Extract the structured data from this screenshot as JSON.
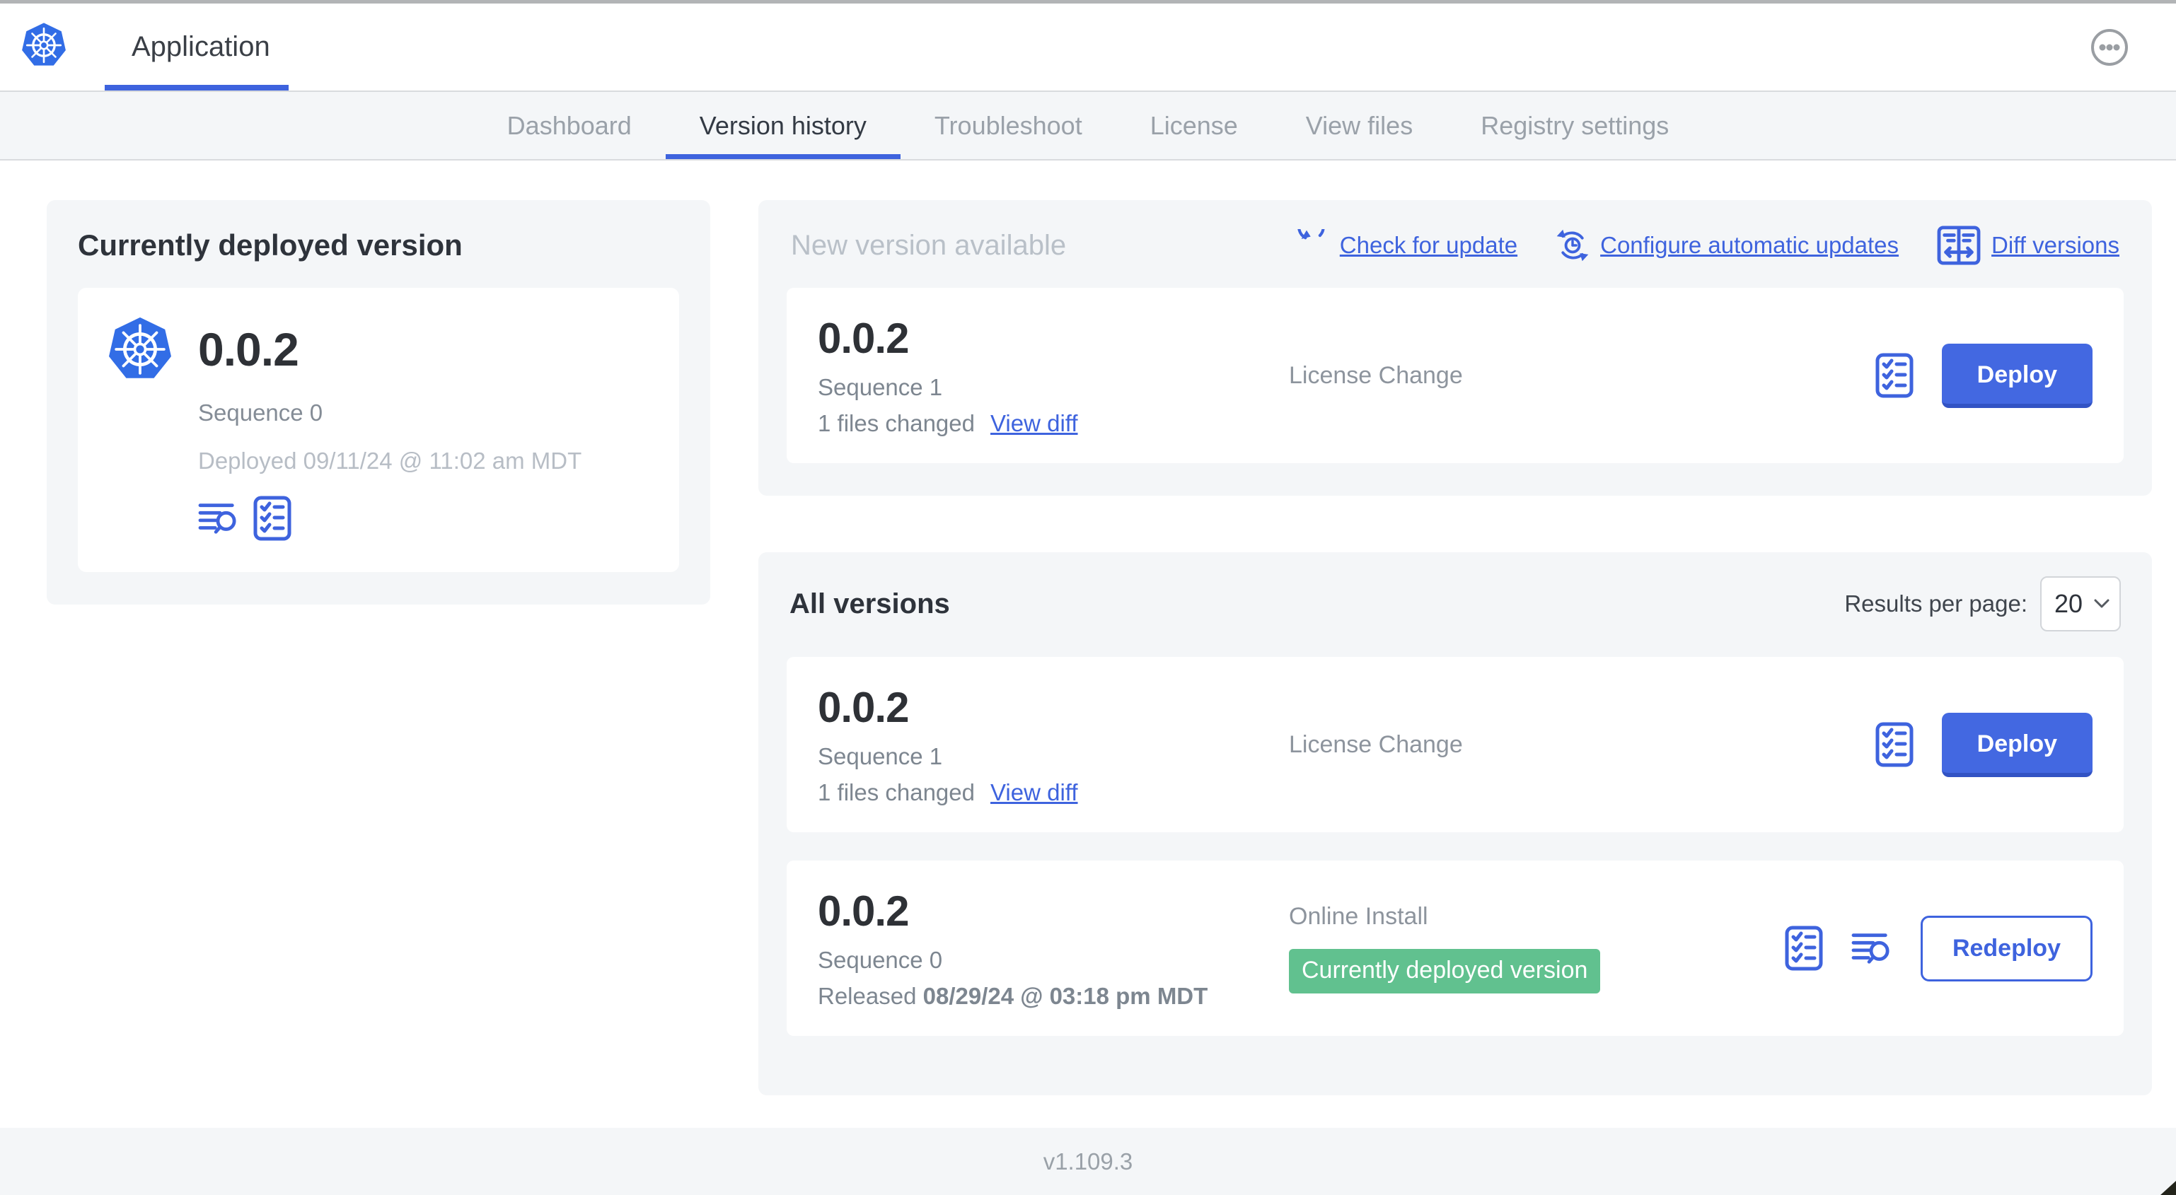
{
  "header": {
    "app_title": "Application"
  },
  "nav": {
    "tabs": [
      {
        "label": "Dashboard",
        "active": false
      },
      {
        "label": "Version history",
        "active": true
      },
      {
        "label": "Troubleshoot",
        "active": false
      },
      {
        "label": "License",
        "active": false
      },
      {
        "label": "View files",
        "active": false
      },
      {
        "label": "Registry settings",
        "active": false
      }
    ]
  },
  "current_version_card": {
    "title": "Currently deployed version",
    "version": "0.0.2",
    "sequence": "Sequence 0",
    "deployed": "Deployed 09/11/24 @ 11:02 am MDT"
  },
  "new_version_section": {
    "title": "New version available",
    "actions": {
      "check_for_update": "Check for update",
      "configure_automatic_updates": "Configure automatic updates",
      "diff_versions": "Diff versions"
    },
    "card": {
      "version": "0.0.2",
      "sequence": "Sequence 1",
      "files_changed": "1 files changed",
      "view_diff": "View diff",
      "source": "License Change",
      "action": "Deploy"
    }
  },
  "all_versions_section": {
    "title": "All versions",
    "results_per_page_label": "Results per page:",
    "results_per_page_value": "20",
    "rows": [
      {
        "version": "0.0.2",
        "sequence": "Sequence 1",
        "files_changed": "1 files changed",
        "view_diff": "View diff",
        "source": "License Change",
        "action": "Deploy"
      },
      {
        "version": "0.0.2",
        "sequence": "Sequence 0",
        "released_prefix": "Released ",
        "released_date": "08/29/24 @ 03:18 pm MDT",
        "source": "Online Install",
        "badge": "Currently deployed version",
        "action": "Redeploy"
      }
    ]
  },
  "footer": {
    "version": "v1.109.3"
  },
  "colors": {
    "accent_blue": "#3e63de",
    "button_blue": "#4368e1",
    "button_blue_shade": "#3253c4",
    "badge_green": "#61c18f",
    "kubernetes_blue": "#326de6",
    "section_bg": "#f4f6f8",
    "muted_text": "#9aa1a9",
    "faint_text": "#b9c0c8",
    "dark_text": "#2e333b"
  },
  "icons": [
    "kubernetes-logo-icon",
    "ellipsis-icon",
    "refresh-icon",
    "auto-update-clock-icon",
    "diff-icon",
    "view-logs-icon",
    "checklist-icon",
    "chevron-down-icon"
  ]
}
